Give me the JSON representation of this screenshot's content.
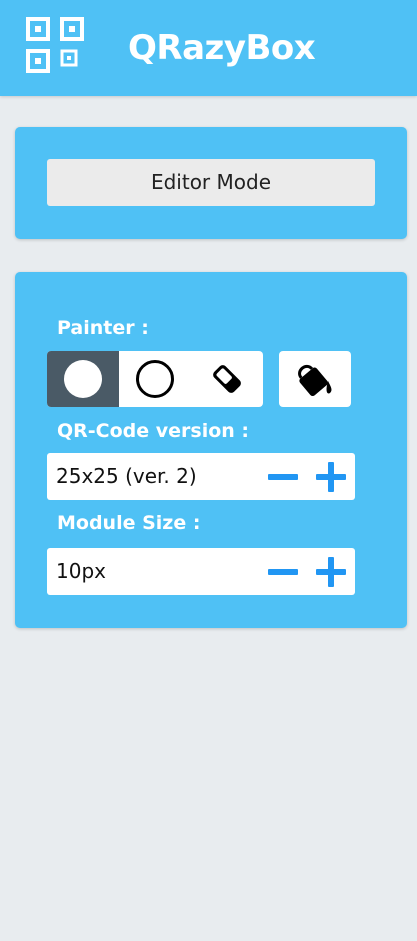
{
  "header": {
    "brand": "QRazyBox",
    "logo_icon": "qr-logo-icon",
    "accent_color": "#4fc1f5"
  },
  "editor": {
    "mode_label": "Editor Mode"
  },
  "tools": {
    "painter_label": "Painter :",
    "painter_buttons": [
      {
        "icon": "filled-circle-icon",
        "active": true
      },
      {
        "icon": "hollow-circle-icon",
        "active": false
      },
      {
        "icon": "eraser-icon",
        "active": false
      }
    ],
    "fill_icon": "paint-bucket-icon",
    "version_label": "QR-Code version :",
    "version_value": "25x25 (ver. 2)",
    "module_size_label": "Module Size :",
    "module_size_value": "10px",
    "stepper_color": "#2196f3"
  }
}
